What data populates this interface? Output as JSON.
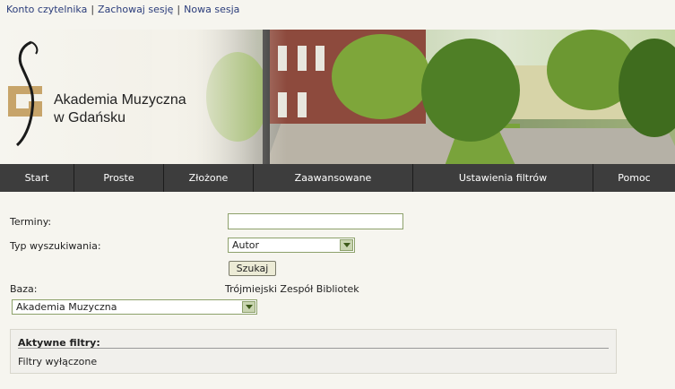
{
  "top_links": [
    "Konto czytelnika",
    "Zachowaj sesję",
    "Nowa sesja"
  ],
  "separator": "|",
  "logo": {
    "line1": "Akademia Muzyczna",
    "line2": "w Gdańsku"
  },
  "nav": [
    "Start",
    "Proste",
    "Złożone",
    "Zaawansowane",
    "Ustawienia filtrów",
    "Pomoc"
  ],
  "form": {
    "terms_label": "Terminy:",
    "terms_value": "",
    "search_type_label": "Typ wyszukiwania:",
    "search_type_value": "Autor",
    "search_button": "Szukaj",
    "base_label": "Baza:",
    "base_group": "Trójmiejski Zespół Bibliotek",
    "base_value": "Akademia Muzyczna"
  },
  "filters": {
    "title": "Aktywne filtry:",
    "text": "Filtry wyłączone"
  },
  "colors": {
    "nav_bg": "#3d3d3d",
    "link": "#2a3c7a",
    "field_border": "#8da16b"
  }
}
